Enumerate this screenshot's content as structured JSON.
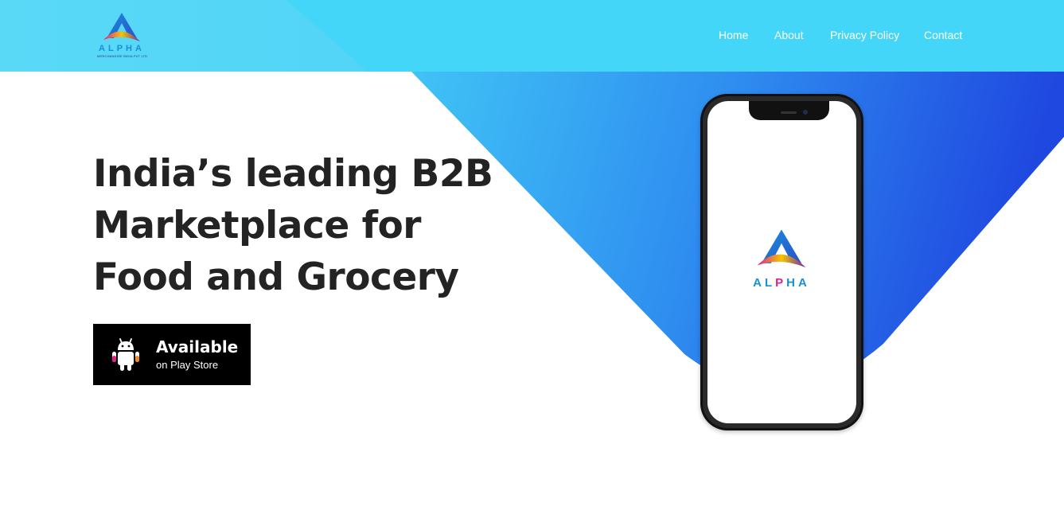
{
  "brand": {
    "name": "ALPHA",
    "tagline": "MERCHANDISE INDIA PVT LTD",
    "logo": "alpha-a-logo",
    "colors": {
      "blue": "#1a8fd6",
      "magenta": "#e0218a",
      "yellow": "#f5c400",
      "purple": "#6a2aa8"
    }
  },
  "nav": {
    "items": [
      {
        "label": "Home"
      },
      {
        "label": "About"
      },
      {
        "label": "Privacy Policy"
      },
      {
        "label": "Contact"
      }
    ]
  },
  "hero": {
    "title": "India’s leading B2B Marketplace for Food and Grocery"
  },
  "play_button": {
    "main": "Available",
    "sub": "on Play Store",
    "icon": "android-icon"
  },
  "phone": {
    "screen_logo_text": [
      "AL",
      "P",
      "HA"
    ]
  },
  "colors": {
    "header_bg": "#4dd8f9",
    "gradient_start": "#40c8f5",
    "gradient_end": "#1f48e0",
    "title_text": "#232323",
    "button_bg": "#000000"
  }
}
